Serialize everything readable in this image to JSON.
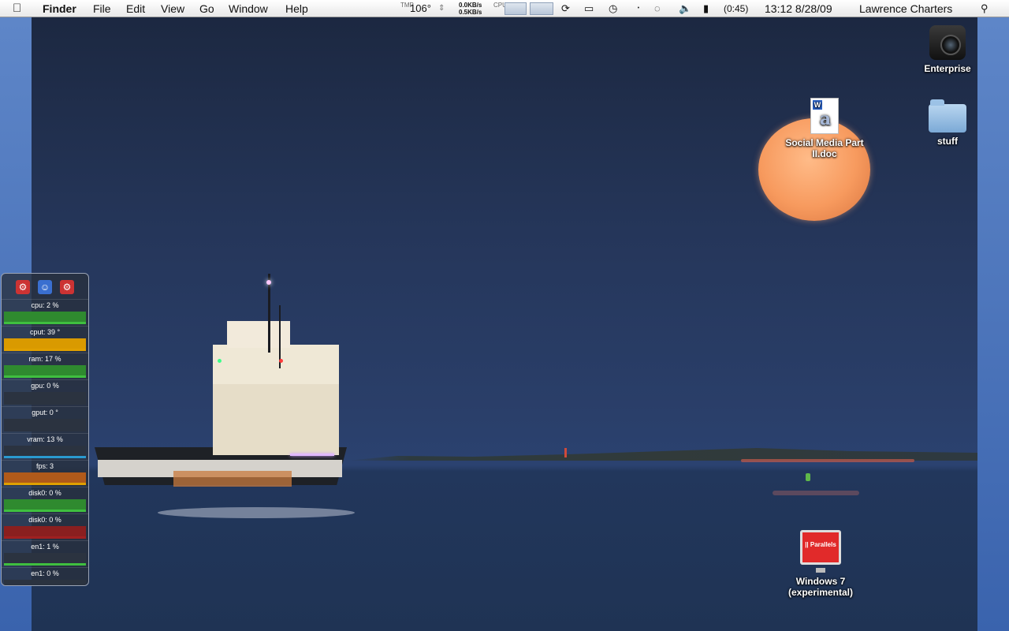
{
  "menubar": {
    "apple_icon": "apple-logo",
    "app_name": "Finder",
    "menus": [
      "File",
      "Edit",
      "View",
      "Go",
      "Window",
      "Help"
    ],
    "temp_label": "TMP",
    "temp_value": "106°",
    "net_up": "0.0KB/s",
    "net_down": "0.5KB/s",
    "cpu_label": "CPU",
    "battery_time": "(0:45)",
    "clock": "13:12 8/28/09",
    "user": "Lawrence Charters",
    "status_icons": [
      "sync-icon",
      "display-icon",
      "time-machine-icon",
      "bluetooth-icon",
      "wifi-icon",
      "volume-icon",
      "battery-icon",
      "spotlight-icon"
    ]
  },
  "desktop": {
    "icons": [
      {
        "label": "Enterprise",
        "kind": "camera"
      },
      {
        "label": "Social Media Part II.doc",
        "kind": "word-document"
      },
      {
        "label": "stuff",
        "kind": "folder"
      },
      {
        "label": "Windows 7 (experimental)",
        "kind": "parallels-vm",
        "badge": "|| Parallels"
      }
    ]
  },
  "monitor": {
    "header_icons": [
      "gear-icon",
      "finder-icon",
      "gear-icon"
    ],
    "rows": [
      {
        "label": "cpu: 2 %",
        "color": "#2f8a2f",
        "bar": "#3fbf3f"
      },
      {
        "label": "cput: 39 °",
        "color": "#d99a00",
        "bar": "#e0a000"
      },
      {
        "label": "ram: 17 %",
        "color": "#2f8a2f",
        "bar": "#3fbf3f"
      },
      {
        "label": "gpu: 0 %",
        "color": "#2b3340",
        "bar": "#2b3340"
      },
      {
        "label": "gput: 0 °",
        "color": "#2b3340",
        "bar": "#2b3340"
      },
      {
        "label": "vram: 13 %",
        "color": "#2b3340",
        "bar": "#2a9ad0"
      },
      {
        "label": "fps: 3",
        "color": "#b05a1a",
        "bar": "#e0a000"
      },
      {
        "label": "disk0: 0 %",
        "color": "#2f8a2f",
        "bar": "#3fbf3f"
      },
      {
        "label": "disk0: 0 %",
        "color": "#8a1f1f",
        "bar": "#a02020"
      },
      {
        "label": "en1: 1 %",
        "color": "#2b3340",
        "bar": "#3fbf3f"
      },
      {
        "label": "en1: 0 %",
        "color": "#2b3340",
        "bar": "#a02020"
      }
    ]
  }
}
